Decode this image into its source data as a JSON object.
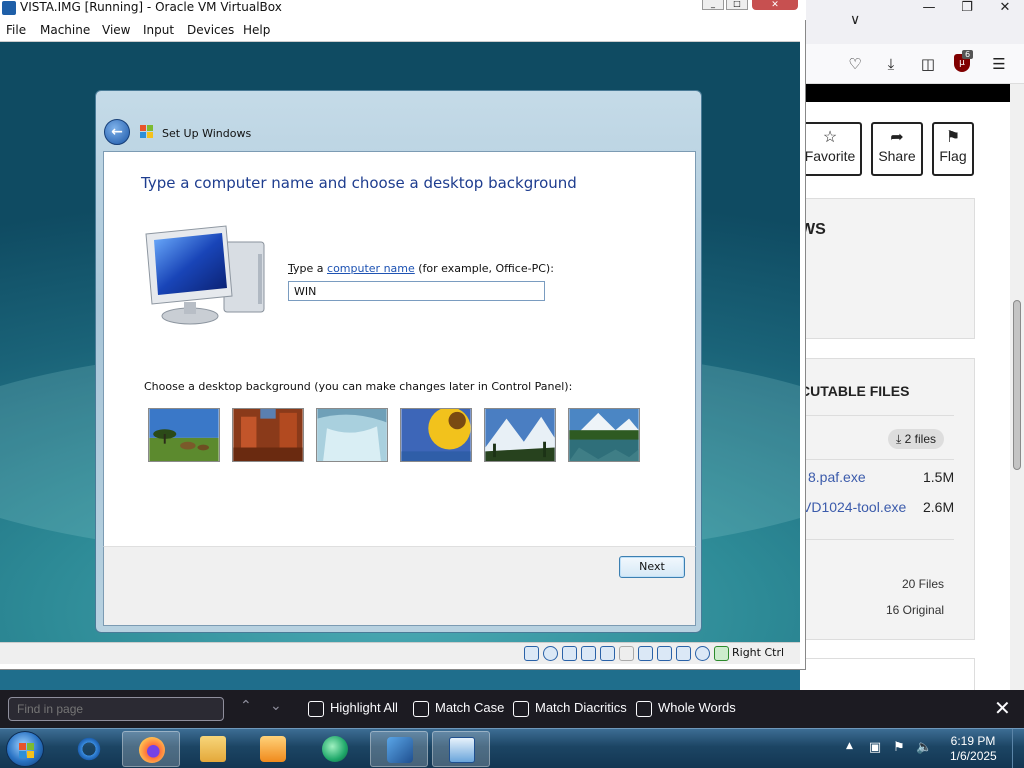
{
  "vbox": {
    "title": "VISTA.IMG [Running] - Oracle VM VirtualBox",
    "menu": [
      "File",
      "Machine",
      "View",
      "Input",
      "Devices",
      "Help"
    ],
    "status_host_key": "Right Ctrl"
  },
  "dialog": {
    "window_title": "Set Up Windows",
    "heading": "Type a computer name and choose a desktop background",
    "name_label_prefix": "ype a ",
    "name_label_underlined": "T",
    "name_label_link": "computer name",
    "name_label_suffix": " (for example, Office-PC):",
    "computer_name_value": "WIN",
    "background_label": "Choose a desktop background (you can make changes later in Control Panel):",
    "backgrounds": [
      "savanna",
      "canyon",
      "waterfall",
      "sunflower",
      "mountains",
      "lake"
    ],
    "next_label": "Next"
  },
  "browser": {
    "actions": [
      "Favorite",
      "Share",
      "Flag"
    ],
    "section_title_partial": "WS",
    "section2_title_partial": "CUTABLE FILES",
    "files_badge": "2 files",
    "files": [
      {
        "name_partial": "8.paf.exe",
        "size": "1.5M"
      },
      {
        "name_partial": "VD1024-tool.exe",
        "size": "2.6M"
      }
    ],
    "stats": [
      "20 Files",
      "16 Original"
    ],
    "ublock_count": "6"
  },
  "findbar": {
    "placeholder": "Find in page",
    "options": [
      "Highlight All",
      "Match Case",
      "Match Diacritics",
      "Whole Words"
    ]
  },
  "taskbar": {
    "time": "6:19 PM",
    "date": "1/6/2025",
    "apps": [
      "internet-explorer",
      "firefox",
      "file-explorer",
      "media-player",
      "app-green",
      "virtualbox",
      "vista-virtualbox"
    ]
  },
  "colors": {
    "heading_blue": "#1e3d8f",
    "link_blue": "#1e53b3",
    "findbar_bg": "#1c1b22",
    "taskbar_blue": "#1c4564"
  }
}
